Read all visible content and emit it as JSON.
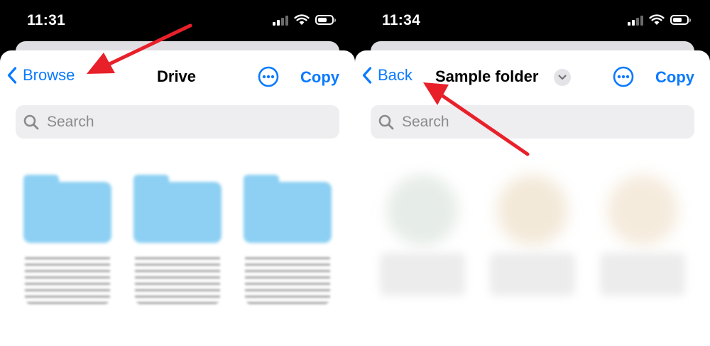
{
  "left": {
    "time": "11:31",
    "back_label": "Browse",
    "title": "Drive",
    "copy_label": "Copy",
    "search_placeholder": "Search"
  },
  "right": {
    "time": "11:34",
    "back_label": "Back",
    "title": "Sample folder",
    "copy_label": "Copy",
    "search_placeholder": "Search"
  },
  "colors": {
    "accent": "#0a7aff",
    "annotation_arrow": "#e8202a",
    "folder": "#8dd0f3"
  },
  "icons": [
    "chevron-left-icon",
    "ellipsis-circle-icon",
    "search-icon",
    "chevron-down-icon",
    "wifi-icon",
    "battery-icon",
    "signal-icon"
  ]
}
